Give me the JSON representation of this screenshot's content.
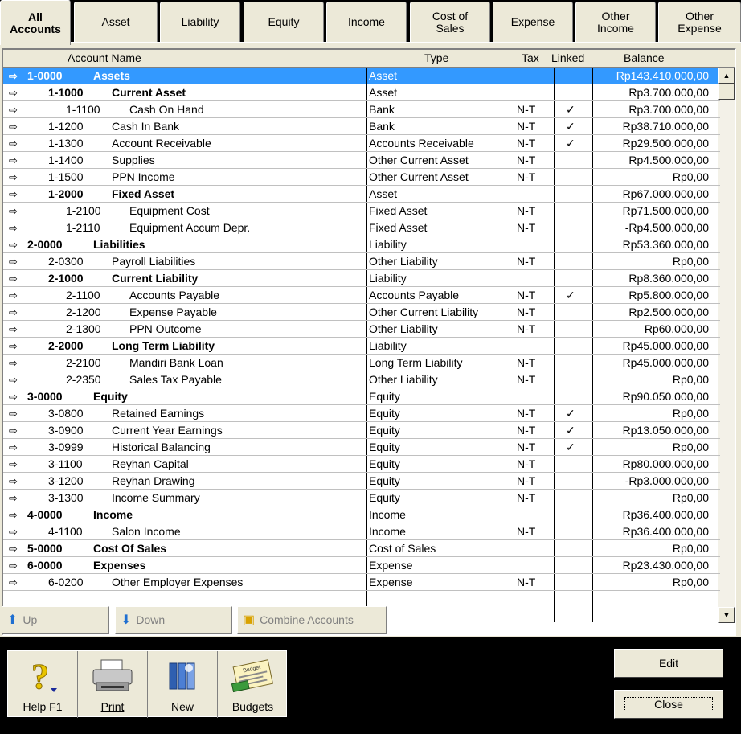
{
  "tabs": [
    {
      "label": "All\nAccounts",
      "active": true
    },
    {
      "label": "Asset"
    },
    {
      "label": "Liability"
    },
    {
      "label": "Equity"
    },
    {
      "label": "Income"
    },
    {
      "label": "Cost of\nSales"
    },
    {
      "label": "Expense"
    },
    {
      "label": "Other\nIncome"
    },
    {
      "label": "Other\nExpense"
    }
  ],
  "columns": {
    "name": "Account Name",
    "type": "Type",
    "tax": "Tax",
    "linked": "Linked",
    "balance": "Balance"
  },
  "rows": [
    {
      "level": 0,
      "number": "1-0000",
      "name": "Assets",
      "type": "Asset",
      "tax": "",
      "linked": "",
      "balance": "Rp143.410.000,00",
      "selected": true
    },
    {
      "level": 1,
      "number": "1-1000",
      "name": "Current Asset",
      "type": "Asset",
      "tax": "",
      "linked": "",
      "balance": "Rp3.700.000,00",
      "header": true
    },
    {
      "level": 2,
      "number": "1-1100",
      "name": "Cash On Hand",
      "type": "Bank",
      "tax": "N-T",
      "linked": "✓",
      "balance": "Rp3.700.000,00"
    },
    {
      "level": 1,
      "number": "1-1200",
      "name": "Cash In Bank",
      "type": "Bank",
      "tax": "N-T",
      "linked": "✓",
      "balance": "Rp38.710.000,00"
    },
    {
      "level": 1,
      "number": "1-1300",
      "name": "Account Receivable",
      "type": "Accounts Receivable",
      "tax": "N-T",
      "linked": "✓",
      "balance": "Rp29.500.000,00"
    },
    {
      "level": 1,
      "number": "1-1400",
      "name": "Supplies",
      "type": "Other Current Asset",
      "tax": "N-T",
      "linked": "",
      "balance": "Rp4.500.000,00"
    },
    {
      "level": 1,
      "number": "1-1500",
      "name": "PPN Income",
      "type": "Other Current Asset",
      "tax": "N-T",
      "linked": "",
      "balance": "Rp0,00"
    },
    {
      "level": 1,
      "number": "1-2000",
      "name": "Fixed Asset",
      "type": "Asset",
      "tax": "",
      "linked": "",
      "balance": "Rp67.000.000,00",
      "header": true
    },
    {
      "level": 2,
      "number": "1-2100",
      "name": "Equipment Cost",
      "type": "Fixed Asset",
      "tax": "N-T",
      "linked": "",
      "balance": "Rp71.500.000,00"
    },
    {
      "level": 2,
      "number": "1-2110",
      "name": "Equipment Accum Depr.",
      "type": "Fixed Asset",
      "tax": "N-T",
      "linked": "",
      "balance": "-Rp4.500.000,00"
    },
    {
      "level": 0,
      "number": "2-0000",
      "name": "Liabilities",
      "type": "Liability",
      "tax": "",
      "linked": "",
      "balance": "Rp53.360.000,00",
      "header": true
    },
    {
      "level": 1,
      "number": "2-0300",
      "name": "Payroll Liabilities",
      "type": "Other Liability",
      "tax": "N-T",
      "linked": "",
      "balance": "Rp0,00"
    },
    {
      "level": 1,
      "number": "2-1000",
      "name": "Current Liability",
      "type": "Liability",
      "tax": "",
      "linked": "",
      "balance": "Rp8.360.000,00",
      "header": true
    },
    {
      "level": 2,
      "number": "2-1100",
      "name": "Accounts Payable",
      "type": "Accounts Payable",
      "tax": "N-T",
      "linked": "✓",
      "balance": "Rp5.800.000,00"
    },
    {
      "level": 2,
      "number": "2-1200",
      "name": "Expense Payable",
      "type": "Other Current Liability",
      "tax": "N-T",
      "linked": "",
      "balance": "Rp2.500.000,00"
    },
    {
      "level": 2,
      "number": "2-1300",
      "name": "PPN Outcome",
      "type": "Other Liability",
      "tax": "N-T",
      "linked": "",
      "balance": "Rp60.000,00"
    },
    {
      "level": 1,
      "number": "2-2000",
      "name": "Long Term Liability",
      "type": "Liability",
      "tax": "",
      "linked": "",
      "balance": "Rp45.000.000,00",
      "header": true
    },
    {
      "level": 2,
      "number": "2-2100",
      "name": "Mandiri Bank Loan",
      "type": "Long Term Liability",
      "tax": "N-T",
      "linked": "",
      "balance": "Rp45.000.000,00"
    },
    {
      "level": 2,
      "number": "2-2350",
      "name": "Sales Tax Payable",
      "type": "Other Liability",
      "tax": "N-T",
      "linked": "",
      "balance": "Rp0,00"
    },
    {
      "level": 0,
      "number": "3-0000",
      "name": "Equity",
      "type": "Equity",
      "tax": "",
      "linked": "",
      "balance": "Rp90.050.000,00",
      "header": true
    },
    {
      "level": 1,
      "number": "3-0800",
      "name": "Retained Earnings",
      "type": "Equity",
      "tax": "N-T",
      "linked": "✓",
      "balance": "Rp0,00"
    },
    {
      "level": 1,
      "number": "3-0900",
      "name": "Current Year Earnings",
      "type": "Equity",
      "tax": "N-T",
      "linked": "✓",
      "balance": "Rp13.050.000,00"
    },
    {
      "level": 1,
      "number": "3-0999",
      "name": "Historical Balancing",
      "type": "Equity",
      "tax": "N-T",
      "linked": "✓",
      "balance": "Rp0,00"
    },
    {
      "level": 1,
      "number": "3-1100",
      "name": "Reyhan Capital",
      "type": "Equity",
      "tax": "N-T",
      "linked": "",
      "balance": "Rp80.000.000,00"
    },
    {
      "level": 1,
      "number": "3-1200",
      "name": "Reyhan Drawing",
      "type": "Equity",
      "tax": "N-T",
      "linked": "",
      "balance": "-Rp3.000.000,00"
    },
    {
      "level": 1,
      "number": "3-1300",
      "name": "Income Summary",
      "type": "Equity",
      "tax": "N-T",
      "linked": "",
      "balance": "Rp0,00"
    },
    {
      "level": 0,
      "number": "4-0000",
      "name": "Income",
      "type": "Income",
      "tax": "",
      "linked": "",
      "balance": "Rp36.400.000,00",
      "header": true
    },
    {
      "level": 1,
      "number": "4-1100",
      "name": "Salon Income",
      "type": "Income",
      "tax": "N-T",
      "linked": "",
      "balance": "Rp36.400.000,00"
    },
    {
      "level": 0,
      "number": "5-0000",
      "name": "Cost Of Sales",
      "type": "Cost of Sales",
      "tax": "",
      "linked": "",
      "balance": "Rp0,00",
      "header": true
    },
    {
      "level": 0,
      "number": "6-0000",
      "name": "Expenses",
      "type": "Expense",
      "tax": "",
      "linked": "",
      "balance": "Rp23.430.000,00",
      "header": true
    },
    {
      "level": 1,
      "number": "6-0200",
      "name": "Other Employer Expenses",
      "type": "Expense",
      "tax": "N-T",
      "linked": "",
      "balance": "Rp0,00"
    }
  ],
  "grid_buttons": {
    "up": "Up",
    "down": "Down",
    "combine": "Combine Accounts"
  },
  "toolbar": {
    "help": "Help F1",
    "print": "Print",
    "new": "New",
    "budgets": "Budgets",
    "budget_pic_label": "Budget"
  },
  "actions": {
    "edit": "Edit",
    "close": "Close"
  },
  "arrow_glyph": "⇨",
  "colors": {
    "selection": "#3399ff",
    "face": "#ece9d8"
  }
}
